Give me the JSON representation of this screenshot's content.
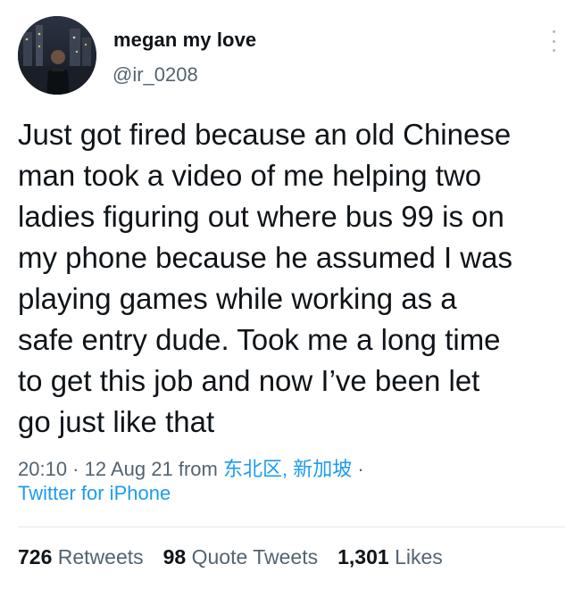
{
  "user": {
    "name": "megan my love",
    "handle": "@ir_0208"
  },
  "tweet": {
    "text": "Just got fired because an old Chinese\nman took a video of me helping two\nladies figuring out where bus 99 is on\nmy phone because he assumed I was\nplaying games while working as a\nsafe entry dude. Took me a long time\nto get this job and now I’ve been let\ngo just like that"
  },
  "meta": {
    "time": "20:10",
    "sep1": " · ",
    "date": "12 Aug 21",
    "from": " from ",
    "location": "东北区, 新加坡",
    "sep2": " ·",
    "client": "Twitter for iPhone"
  },
  "stats": {
    "retweets": {
      "count": "726",
      "label": "Retweets"
    },
    "quotes": {
      "count": "98",
      "label": "Quote Tweets"
    },
    "likes": {
      "count": "1,301",
      "label": "Likes"
    }
  },
  "icons": {
    "more": "more-vertical-icon"
  }
}
